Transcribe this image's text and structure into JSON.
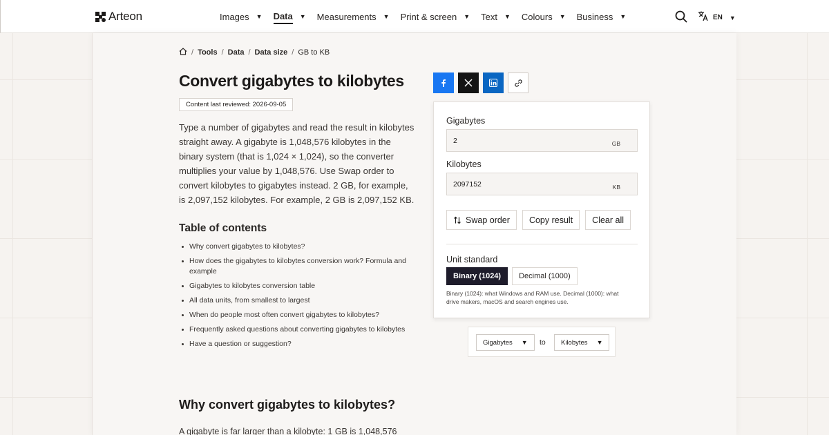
{
  "brand": {
    "name": "Arteon"
  },
  "nav": {
    "items": [
      {
        "label": "Images"
      },
      {
        "label": "Data"
      },
      {
        "label": "Measurements"
      },
      {
        "label": "Print & screen"
      },
      {
        "label": "Text"
      },
      {
        "label": "Colours"
      },
      {
        "label": "Business"
      }
    ],
    "active": "Data",
    "language": "EN"
  },
  "breadcrumb": {
    "items": [
      "Tools",
      "Data",
      "Data size"
    ],
    "current": "GB to KB"
  },
  "page": {
    "title": "Convert gigabytes to kilobytes",
    "reviewed": "Content last reviewed: 2026-09-05",
    "intro": "Type a number of gigabytes and read the result in kilobytes straight away. A gigabyte is 1,048,576 kilobytes in the binary system (that is 1,024 × 1,024), so the converter multiplies your value by 1,048,576. Use Swap order to convert kilobytes to gigabytes instead. 2 GB, for example, is 2,097,152 kilobytes. For example, 2 GB is 2,097,152 KB.",
    "toc_title": "Table of contents",
    "toc": [
      "Why convert gigabytes to kilobytes?",
      "How does the gigabytes to kilobytes conversion work? Formula and example",
      "Gigabytes to kilobytes conversion table",
      "All data units, from smallest to largest",
      "When do people most often convert gigabytes to kilobytes?",
      "Frequently asked questions about converting gigabytes to kilobytes",
      "Have a question or suggestion?"
    ],
    "section_heading": "Why convert gigabytes to kilobytes?",
    "section_text_start": "A gigabyte is far larger than a kilobyte: 1 GB is 1,048,576"
  },
  "share": {
    "icons": [
      "facebook-icon",
      "x-icon",
      "linkedin-icon",
      "link-icon"
    ]
  },
  "converter": {
    "from_label": "Gigabytes",
    "from_value": "2",
    "from_unit": "GB",
    "to_label": "Kilobytes",
    "to_value": "2097152",
    "to_unit": "KB",
    "swap_label": "Swap order",
    "copy_label": "Copy result",
    "clear_label": "Clear all",
    "standard_label": "Unit standard",
    "standard_options": [
      "Binary (1024)",
      "Decimal (1000)"
    ],
    "standard_selected": "Binary (1024)",
    "standard_note": "Binary (1024): what Windows and RAM use. Decimal (1000): what drive makers, macOS and search engines use."
  },
  "unit_selector": {
    "from": "Gigabytes",
    "to_word": "to",
    "to": "Kilobytes"
  },
  "colors": {
    "accent_dark": "#1e1c2b",
    "facebook": "#1877f2",
    "x": "#141414",
    "linkedin": "#0a66c2"
  }
}
